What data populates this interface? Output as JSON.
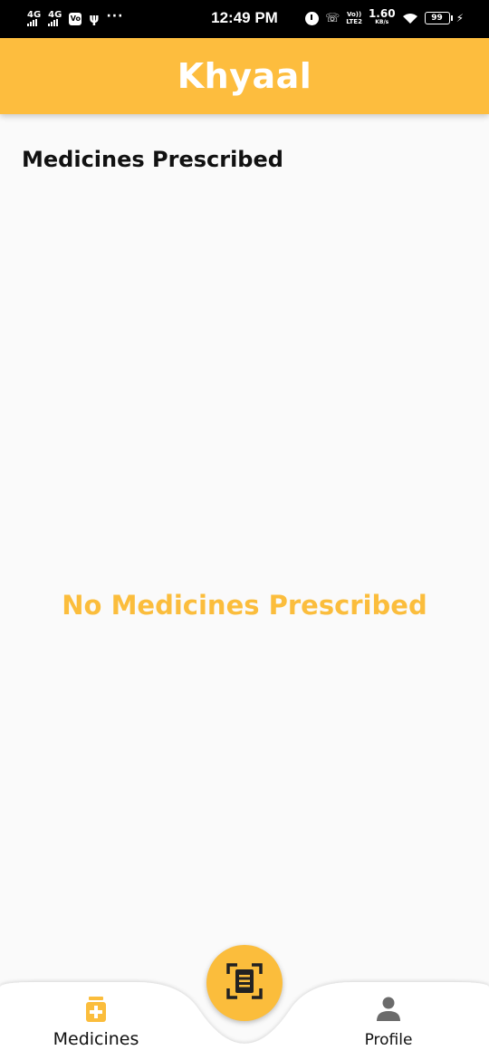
{
  "status_bar": {
    "time": "12:49 PM",
    "net1": "4G",
    "net2": "4G",
    "volte_box": "Vo",
    "speed_value": "1.60",
    "speed_unit": "KB/s",
    "lte_top": "Vo))",
    "lte_bottom": "LTE2",
    "battery": "99"
  },
  "app_bar": {
    "title": "Khyaal"
  },
  "main": {
    "section_title": "Medicines Prescribed",
    "empty_message": "No Medicines Prescribed"
  },
  "bottom_nav": {
    "items": [
      {
        "label": "Medicines",
        "icon": "medicine-icon",
        "active": true
      },
      {
        "label": "Profile",
        "icon": "person-icon",
        "active": false
      }
    ],
    "fab_icon": "scan-document-icon"
  },
  "colors": {
    "accent": "#fbbd3c",
    "app_bar": "#fdbd3e",
    "background": "#fafafa",
    "inactive_icon": "#6b6b6b"
  }
}
